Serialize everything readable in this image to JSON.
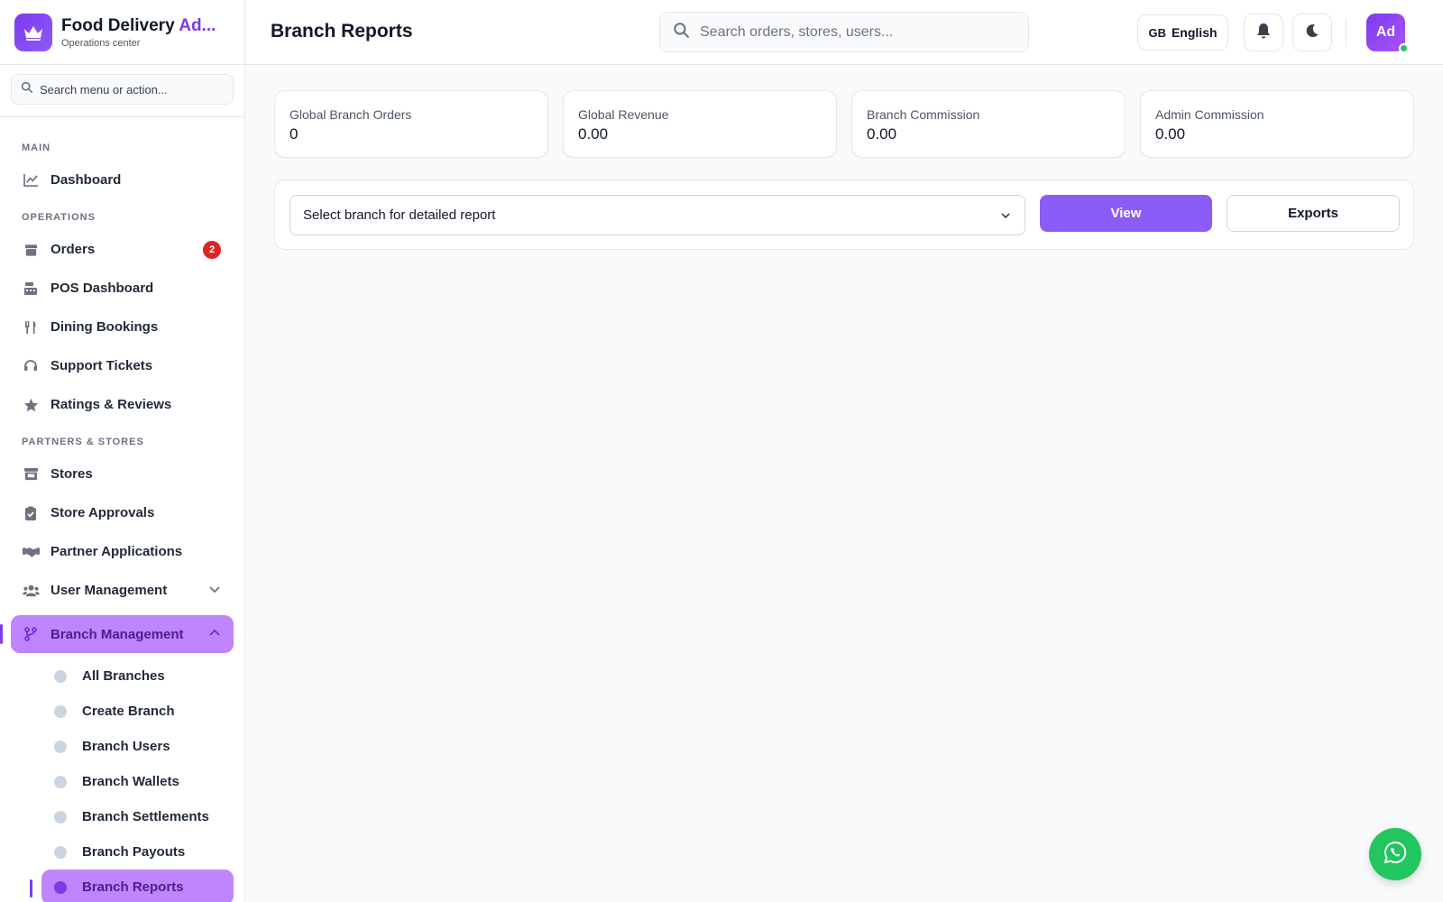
{
  "brand": {
    "title_main": "Food Delivery ",
    "title_accent": "Ad...",
    "subtitle": "Operations center",
    "logo_icon": "crown-icon"
  },
  "sidebar": {
    "search_placeholder": "Search menu or action...",
    "sections": {
      "main": "MAIN",
      "operations": "OPERATIONS",
      "partners": "PARTNERS & STORES"
    },
    "items": {
      "dashboard": "Dashboard",
      "orders": "Orders",
      "orders_badge": "2",
      "pos": "POS Dashboard",
      "dining": "Dining Bookings",
      "support": "Support Tickets",
      "ratings": "Ratings & Reviews",
      "stores": "Stores",
      "store_approvals": "Store Approvals",
      "partner_applications": "Partner Applications",
      "user_management": "User Management",
      "branch_management": "Branch Management"
    },
    "branch_sub": [
      "All Branches",
      "Create Branch",
      "Branch Users",
      "Branch Wallets",
      "Branch Settlements",
      "Branch Payouts",
      "Branch Reports"
    ]
  },
  "header": {
    "page_title": "Branch Reports",
    "search_placeholder": "Search orders, stores, users...",
    "lang_code": "GB",
    "lang_name": "English",
    "avatar_initials": "Ad"
  },
  "stats": [
    {
      "label": "Global Branch Orders",
      "value": "0"
    },
    {
      "label": "Global Revenue",
      "value": "0.00"
    },
    {
      "label": "Branch Commission",
      "value": "0.00"
    },
    {
      "label": "Admin Commission",
      "value": "0.00"
    }
  ],
  "filter": {
    "select_value": "Select branch for detailed report",
    "view_label": "View",
    "export_label": "Exports"
  },
  "colors": {
    "accent": "#8b5cf6",
    "active_bg": "#c084fc",
    "badge": "#dc2626",
    "whatsapp": "#22c55e"
  }
}
